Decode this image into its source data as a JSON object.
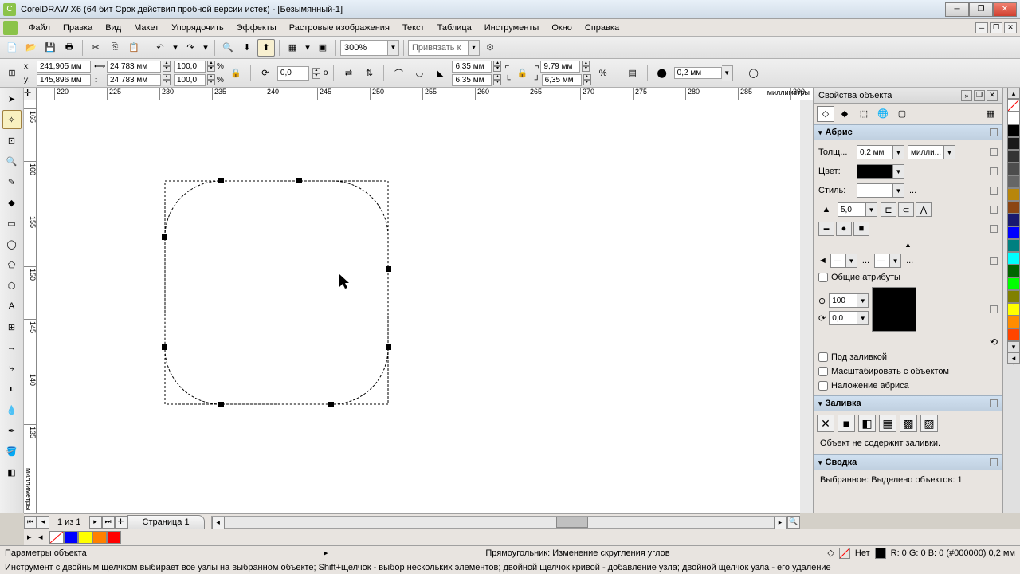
{
  "title": "CorelDRAW X6 (64 бит Срок действия пробной версии истек) - [Безымянный-1]",
  "menu": [
    "Файл",
    "Правка",
    "Вид",
    "Макет",
    "Упорядочить",
    "Эффекты",
    "Растровые изображения",
    "Текст",
    "Таблица",
    "Инструменты",
    "Окно",
    "Справка"
  ],
  "toolbar1": {
    "zoom": "300%",
    "snap": "Привязать к"
  },
  "propbar": {
    "x": "241,905 мм",
    "y": "145,896 мм",
    "w": "24,783 мм",
    "h": "24,783 мм",
    "sx": "100,0",
    "sy": "100,0",
    "pct": "%",
    "rot": "0,0",
    "deg": "o",
    "cx": "6,35 мм",
    "cy": "6,35 мм",
    "cx2": "9,79 мм",
    "cy2": "6,35 мм",
    "outline": "0,2 мм"
  },
  "ruler": {
    "unit": "миллиметры",
    "hticks": [
      "220",
      "225",
      "230",
      "235",
      "240",
      "245",
      "250",
      "255",
      "260",
      "265",
      "270",
      "275",
      "280",
      "285",
      "290"
    ],
    "vticks": [
      "165",
      "160",
      "155",
      "150",
      "145",
      "140",
      "135"
    ]
  },
  "panel": {
    "title": "Свойства объекта",
    "outline": {
      "hdr": "Абрис",
      "width_l": "Толщ...",
      "width_v": "0,2 мм",
      "width_u": "милли...",
      "color_l": "Цвет:",
      "style_l": "Стиль:",
      "miter": "5,0",
      "shared": "Общие атрибуты",
      "opacity": "100",
      "angle": "0,0",
      "behind": "Под заливкой",
      "scale": "Масштабировать с объектом",
      "overprint": "Наложение абриса"
    },
    "fill": {
      "hdr": "Заливка",
      "none": "Объект не содержит заливки."
    },
    "summary": {
      "hdr": "Сводка",
      "sel": "Выбранное: Выделено объектов: 1"
    }
  },
  "page": {
    "count": "1 из 1",
    "tab": "Страница 1"
  },
  "status": {
    "left": "Параметры объекта",
    "mid": "Прямоугольник: Изменение скругления углов",
    "fill": "Нет",
    "rgb": "R: 0 G: 0 B: 0 (#000000)  0,2 мм"
  },
  "hint": "Инструмент с двойным щелчком выбирает все узлы на выбранном объекте; Shift+щелчок - выбор нескольких элементов; двойной щелчок кривой - добавление узла; двойной щелчок узла - его удаление",
  "palette": [
    "#ffffff",
    "#000000",
    "#1a1a1a",
    "#333333",
    "#4d4d4d",
    "#666666",
    "#b8860b",
    "#8b4513",
    "#191970",
    "#0000ff",
    "#008080",
    "#00ffff",
    "#006400",
    "#00ff00",
    "#808000",
    "#ffff00",
    "#ff8c00",
    "#ff4500"
  ]
}
